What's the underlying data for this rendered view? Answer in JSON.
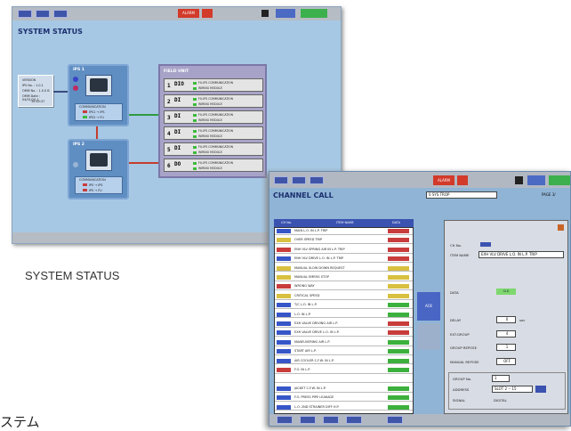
{
  "system_status": {
    "title": "SYSTEM STATUS",
    "alarm": "ALARM",
    "version_box": [
      "VERSION",
      "IPS No. : 1.0.1",
      "OMM No. : 1.0.0 B",
      "OMM Date : 04/01/20-1",
      "10:45:37"
    ],
    "ips1": {
      "label": "IPS 1",
      "comm": "COMMUNICATION",
      "l1": "IPS1 → IPS",
      "l2": "IPS2 → FU"
    },
    "ips2": {
      "label": "IPS 2",
      "comm": "COMMUNICATION",
      "l1": "IPS → IPS",
      "l2": "IPS → FU"
    },
    "field_unit": {
      "title": "FIELD UNIT",
      "rows": [
        {
          "n": "1",
          "d": "DIO",
          "s1": "FU-IPS COMMUNICATION",
          "s2": "WIRING MODULE"
        },
        {
          "n": "2",
          "d": "DI",
          "s1": "FU-IPS COMMUNICATION",
          "s2": "WIRING MODULE"
        },
        {
          "n": "3",
          "d": "DI",
          "s1": "FU-IPS COMMUNICATION",
          "s2": "WIRING MODULE"
        },
        {
          "n": "4",
          "d": "DI",
          "s1": "FU-IPS COMMUNICATION",
          "s2": "WIRING MODULE"
        },
        {
          "n": "5",
          "d": "DI",
          "s1": "FU-IPS COMMUNICATION",
          "s2": "WIRING MODULE"
        },
        {
          "n": "6",
          "d": "DO",
          "s1": "FU-IPS COMMUNICATION",
          "s2": "WIRING MODULE"
        }
      ]
    }
  },
  "caption_system": "SYSTEM STATUS",
  "caption_jp": "ステム",
  "channel_call": {
    "title": "CHANNEL CALL",
    "search": "0  SYS TROP",
    "page": "PAGE  3/",
    "alarm": "ALARM",
    "headers": [
      "CH No.",
      "ITEM NAME",
      "DATA"
    ],
    "rows": [
      {
        "name": "MAIN L.O. IN L.P. TRIP",
        "sw": "#3656c8",
        "dt": "#c83c3c"
      },
      {
        "name": "OVER SPEED TRIP",
        "sw": "#d8c040",
        "dt": "#c83c3c"
      },
      {
        "name": "ENH VLV SPRING AIR IN L.P. TRIP",
        "sw": "#c83c3c",
        "dt": "#c83c3c"
      },
      {
        "name": "ENH VLV DRIVE L.O. IN L.P. TRIP",
        "sw": "#3656c8",
        "dt": "#c83c3c"
      },
      {
        "name": "MANUAL SLOW DOWN REQUEST",
        "sw": "#d8c040",
        "dt": "#d8c040"
      },
      {
        "name": "MANUAL EMERG STOP",
        "sw": "#d8c040",
        "dt": "#d8c040"
      },
      {
        "name": "WRONG WAY",
        "sw": "#c83c3c",
        "dt": "#d8c040"
      },
      {
        "name": "CRITICAL SPEED",
        "sw": "#d8c040",
        "dt": "#d8c040"
      },
      {
        "name": "T/C L.O. IN L.P.",
        "sw": "#3656c8",
        "dt": "#3cb03c"
      },
      {
        "name": "L.O. IN L.P.",
        "sw": "#3656c8",
        "dt": "#3cb03c"
      },
      {
        "name": "EXH VALVE DRIVING AIR L.P.",
        "sw": "#3656c8",
        "dt": "#c83c3c"
      },
      {
        "name": "EXH VALVE DRIVE L.O. IN L.P.",
        "sw": "#3656c8",
        "dt": "#c83c3c"
      },
      {
        "name": "MANEUVERING AIR L.P.",
        "sw": "#3656c8",
        "dt": "#3cb03c"
      },
      {
        "name": "START AIR L.P.",
        "sw": "#3656c8",
        "dt": "#3cb03c"
      },
      {
        "name": "AIR COOLER C.F.W. IN L.P.",
        "sw": "#3656c8",
        "dt": "#3cb03c"
      },
      {
        "name": "F.O. IN L.P.",
        "sw": "#c83c3c",
        "dt": "#3cb03c"
      },
      {
        "name": "",
        "sw": "#ffffff",
        "dt": "#ffffff"
      },
      {
        "name": "JACKET C.F.W. IN L.P.",
        "sw": "#3656c8",
        "dt": "#3cb03c"
      },
      {
        "name": "F.O. PRESS PIPE LEAKAGE",
        "sw": "#3656c8",
        "dt": "#3cb03c"
      },
      {
        "name": "L.O. 2ND STRAINER DIFF H.P.",
        "sw": "#3656c8",
        "dt": "#3cb03c"
      }
    ],
    "mid_button": "ACK",
    "details": {
      "ch_no": "CH No.",
      "item_name": "ITEM NAME",
      "item_value": "EXH VLV DRIVE L.O. IN L.P. TRIP",
      "data": "DATA",
      "data_value": "SLD",
      "delay": "DELAY",
      "delay_value": "0",
      "delay_unit": "sec",
      "ext_group": "EXT.GROUP",
      "ext_group_value": "4",
      "group_repose": "GROUP REPOSE",
      "group_repose_value": "1",
      "manual_repose": "MANUAL REPOSE",
      "manual_repose_value": "OFF",
      "group_no": "GROUP No.",
      "group_no_value": "1",
      "address": "ADDRESS",
      "address_value": "SLOT 2 -- 15",
      "signal": "SIGNAL",
      "signal_value": "DIGITAL"
    }
  }
}
